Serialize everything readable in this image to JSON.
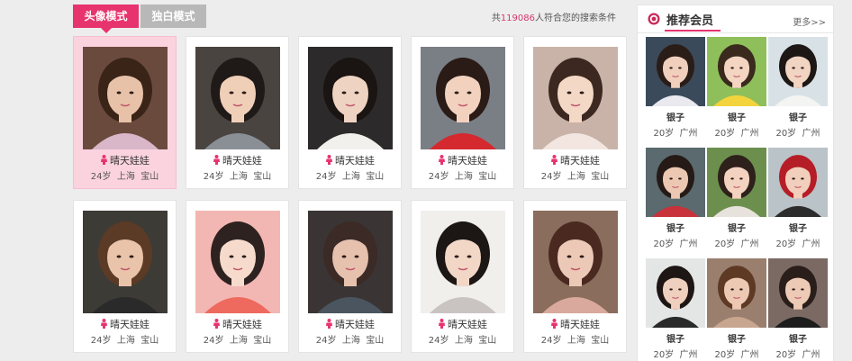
{
  "tabs": {
    "avatar_mode": "头像模式",
    "monologue_mode": "独白模式"
  },
  "result": {
    "prefix": "共",
    "count": "119086",
    "suffix": "人符合您的搜索条件"
  },
  "colors": {
    "accent": "#e7336e",
    "active_card": "#fbd3df",
    "tab_inactive": "#b9b8b8"
  },
  "members": [
    {
      "name": "晴天娃娃",
      "age": "24岁",
      "city": "上海",
      "district": "宝山"
    },
    {
      "name": "晴天娃娃",
      "age": "24岁",
      "city": "上海",
      "district": "宝山"
    },
    {
      "name": "晴天娃娃",
      "age": "24岁",
      "city": "上海",
      "district": "宝山"
    },
    {
      "name": "晴天娃娃",
      "age": "24岁",
      "city": "上海",
      "district": "宝山"
    },
    {
      "name": "晴天娃娃",
      "age": "24岁",
      "city": "上海",
      "district": "宝山"
    },
    {
      "name": "晴天娃娃",
      "age": "24岁",
      "city": "上海",
      "district": "宝山"
    },
    {
      "name": "晴天娃娃",
      "age": "24岁",
      "city": "上海",
      "district": "宝山"
    },
    {
      "name": "晴天娃娃",
      "age": "24岁",
      "city": "上海",
      "district": "宝山"
    },
    {
      "name": "晴天娃娃",
      "age": "24岁",
      "city": "上海",
      "district": "宝山"
    },
    {
      "name": "晴天娃娃",
      "age": "24岁",
      "city": "上海",
      "district": "宝山"
    }
  ],
  "sidebar": {
    "title": "推荐会员",
    "more": "更多>>",
    "icon": "record-icon",
    "members": [
      {
        "name": "银子",
        "age": "20岁",
        "city": "广州"
      },
      {
        "name": "银子",
        "age": "20岁",
        "city": "广州"
      },
      {
        "name": "银子",
        "age": "20岁",
        "city": "广州"
      },
      {
        "name": "银子",
        "age": "20岁",
        "city": "广州"
      },
      {
        "name": "银子",
        "age": "20岁",
        "city": "广州"
      },
      {
        "name": "银子",
        "age": "20岁",
        "city": "广州"
      },
      {
        "name": "银子",
        "age": "20岁",
        "city": "广州"
      },
      {
        "name": "银子",
        "age": "20岁",
        "city": "广州"
      },
      {
        "name": "银子",
        "age": "20岁",
        "city": "广州"
      }
    ]
  }
}
